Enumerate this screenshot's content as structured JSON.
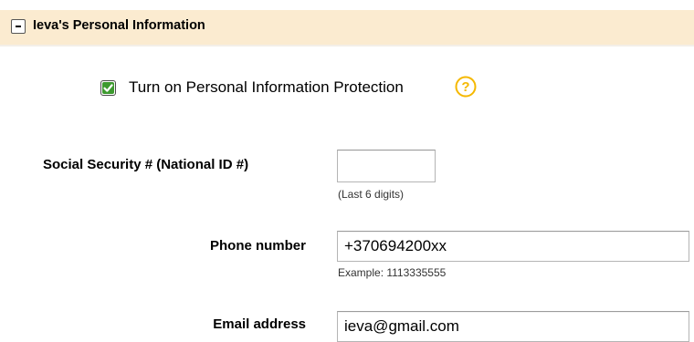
{
  "section": {
    "title": "Ieva's Personal Information",
    "collapse_icon": "minus-icon"
  },
  "protection": {
    "checked": true,
    "label": "Turn on Personal Information Protection",
    "help_icon": "question-mark-icon",
    "help_color": "#f5b800"
  },
  "fields": {
    "ssn": {
      "label": "Social Security # (National ID #)",
      "value": "",
      "hint": "(Last 6 digits)"
    },
    "phone": {
      "label": "Phone number",
      "value": "+370694200xx",
      "hint": "Example: 1113335555"
    },
    "email": {
      "label": "Email address",
      "value": "ieva@gmail.com"
    }
  }
}
